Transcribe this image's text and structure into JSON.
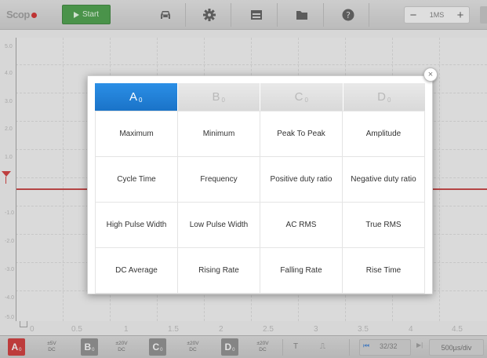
{
  "toolbar": {
    "brand": "Scop",
    "start_label": "Start",
    "icons": [
      "car-icon",
      "gear-icon",
      "window-icon",
      "folder-icon",
      "help-icon"
    ],
    "timebase": {
      "minus": "−",
      "value": "1MS",
      "plus": "+"
    }
  },
  "plot": {
    "y_labels": [
      "5.0",
      "4.0",
      "3.0",
      "2.0",
      "1.0",
      "0",
      "-1.0",
      "-2.0",
      "-3.0",
      "-4.0",
      "-5.0"
    ],
    "x_labels": [
      "0",
      "0.5",
      "1",
      "1.5",
      "2",
      "2.5",
      "3",
      "3.5",
      "4",
      "4.5"
    ],
    "trace_color": "#c73838"
  },
  "dialog": {
    "close": "×",
    "tabs": [
      {
        "letter": "A",
        "sub": "0"
      },
      {
        "letter": "B",
        "sub": "0"
      },
      {
        "letter": "C",
        "sub": "0"
      },
      {
        "letter": "D",
        "sub": "0"
      }
    ],
    "active_tab": "A",
    "measurements": [
      "Maximum",
      "Minimum",
      "Peak To Peak",
      "Amplitude",
      "Cycle Time",
      "Frequency",
      "Positive duty ratio",
      "Negative duty ratio",
      "High Pulse Width",
      "Low Pulse Width",
      "AC RMS",
      "True RMS",
      "DC Average",
      "Rising Rate",
      "Falling Rate",
      "Rise Time"
    ]
  },
  "bottombar": {
    "channels": [
      {
        "letter": "A",
        "sub": "0",
        "range": "±5V",
        "coupling": "DC",
        "color": "#d12c2c"
      },
      {
        "letter": "B",
        "sub": "0",
        "range": "±20V",
        "coupling": "DC",
        "color": "#8a8a8a"
      },
      {
        "letter": "C",
        "sub": "0",
        "range": "±20V",
        "coupling": "DC",
        "color": "#8a8a8a"
      },
      {
        "letter": "D",
        "sub": "0",
        "range": "±20V",
        "coupling": "DC",
        "color": "#8a8a8a"
      }
    ],
    "trigger_icon": "T",
    "edge_icon": "⎍",
    "page_first": "⏮",
    "page_indicator": "32/32",
    "page_next": "▶|",
    "time_div": "500µs/div"
  }
}
